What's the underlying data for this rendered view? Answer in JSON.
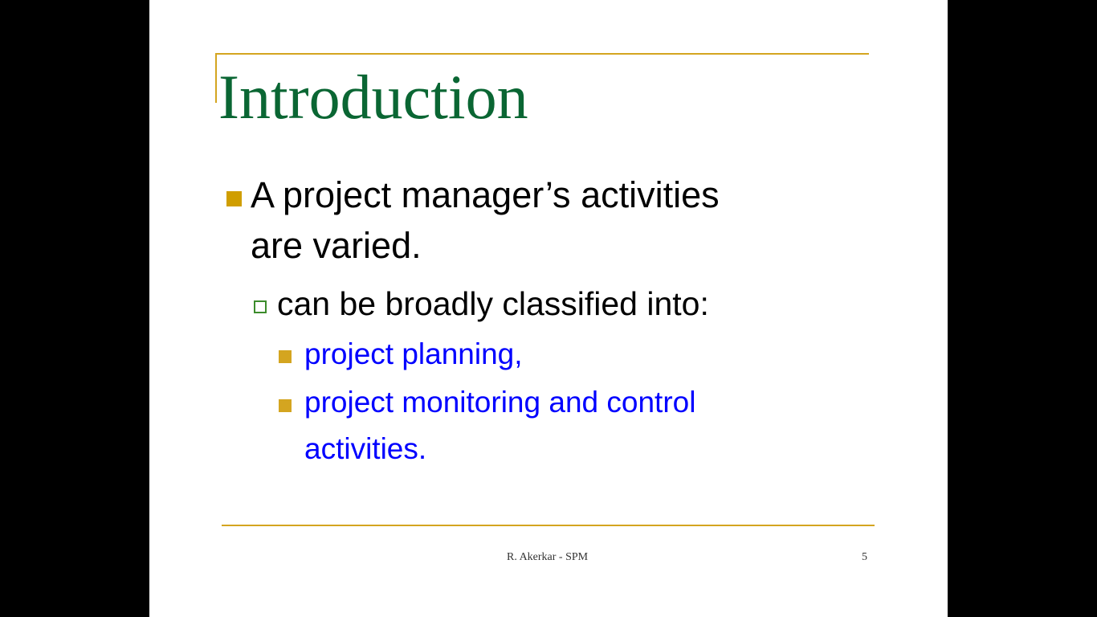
{
  "slide": {
    "title": "Introduction",
    "bullet1": {
      "lines": [
        "A project manager’s activities",
        "are varied."
      ]
    },
    "bullet2": {
      "text": "can be broadly classified into:"
    },
    "bullet3a": {
      "text": "project planning,"
    },
    "bullet3b": {
      "lines": [
        "project monitoring and control",
        "activities."
      ]
    },
    "footer": {
      "author": "R. Akerkar - SPM",
      "page": "5"
    }
  },
  "colors": {
    "title": "#0a6633",
    "accent": "#d4a520",
    "sub_bullet": "#0000ff"
  }
}
